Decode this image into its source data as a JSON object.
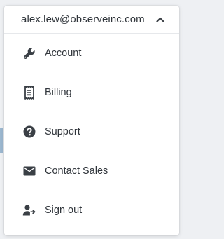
{
  "user_menu": {
    "email": "alex.lew@observeinc.com",
    "toggle_icon": "chevron-up-icon",
    "items": [
      {
        "label": "Account",
        "icon": "wrench-icon"
      },
      {
        "label": "Billing",
        "icon": "receipt-icon"
      },
      {
        "label": "Support",
        "icon": "question-circle-icon"
      },
      {
        "label": "Contact Sales",
        "icon": "envelope-icon"
      },
      {
        "label": "Sign out",
        "icon": "sign-out-icon"
      }
    ]
  },
  "colors": {
    "icon": "#3a3f45",
    "text": "#30353b",
    "panel": "#ffffff",
    "backdrop": "#eef0f3"
  }
}
